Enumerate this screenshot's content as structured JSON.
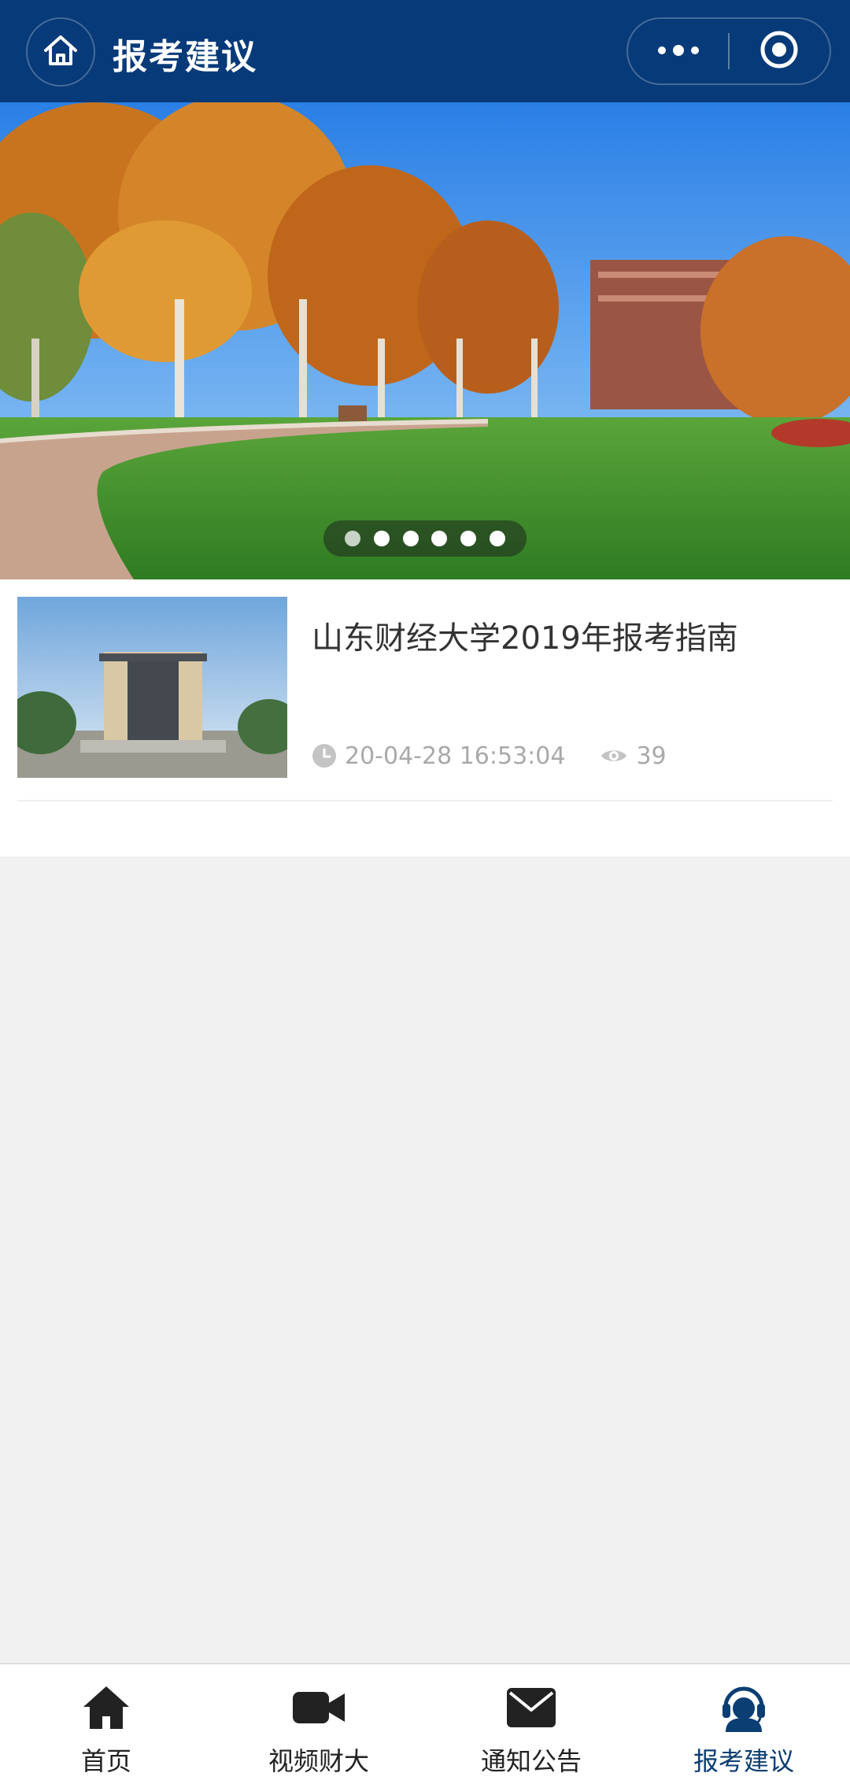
{
  "header": {
    "title": "报考建议",
    "home_icon": "home-icon",
    "more_icon": "more-dots-icon",
    "capsule_target_icon": "target-circle-icon",
    "background_color": "#073a78"
  },
  "banner": {
    "slide_count": 6,
    "active_index": 0
  },
  "articles": [
    {
      "title": "山东财经大学2019年报考指南",
      "date": "20-04-28 16:53:04",
      "views": "39"
    }
  ],
  "tabbar": {
    "active_color": "#0b3e73",
    "tabs": [
      {
        "label": "首页",
        "icon": "home-icon"
      },
      {
        "label": "视频财大",
        "icon": "video-camera-icon"
      },
      {
        "label": "通知公告",
        "icon": "envelope-icon"
      },
      {
        "label": "报考建议",
        "icon": "headset-agent-icon",
        "active": true
      }
    ]
  }
}
